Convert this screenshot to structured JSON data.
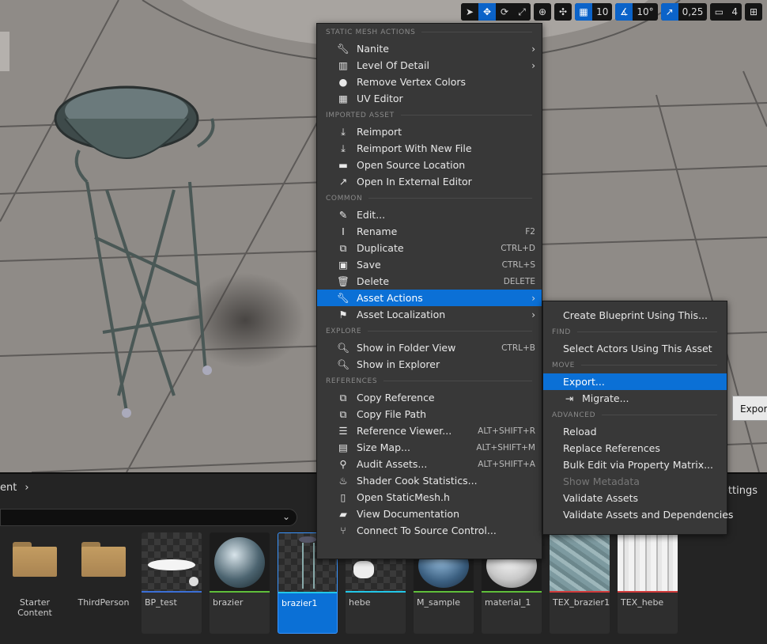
{
  "toolbar": {
    "grid_snap": "10",
    "rotation_snap": "10°",
    "scale_snap": "0,25",
    "camera_speed": "4"
  },
  "context_menu": {
    "sections": {
      "static_mesh_actions": "STATIC MESH ACTIONS",
      "imported_asset": "IMPORTED ASSET",
      "common": "COMMON",
      "explore": "EXPLORE",
      "references": "REFERENCES"
    },
    "items": {
      "nanite": "Nanite",
      "level_of_detail": "Level Of Detail",
      "remove_vertex_colors": "Remove Vertex Colors",
      "uv_editor": "UV Editor",
      "reimport": "Reimport",
      "reimport_new_file": "Reimport With New File",
      "open_source_location": "Open Source Location",
      "open_external_editor": "Open In External Editor",
      "edit": "Edit...",
      "rename": "Rename",
      "rename_sc": "F2",
      "duplicate": "Duplicate",
      "duplicate_sc": "CTRL+D",
      "save": "Save",
      "save_sc": "CTRL+S",
      "delete": "Delete",
      "delete_sc": "DELETE",
      "asset_actions": "Asset Actions",
      "asset_localization": "Asset Localization",
      "show_folder_view": "Show in Folder View",
      "show_folder_view_sc": "CTRL+B",
      "show_explorer": "Show in Explorer",
      "copy_reference": "Copy Reference",
      "copy_file_path": "Copy File Path",
      "reference_viewer": "Reference Viewer...",
      "reference_viewer_sc": "ALT+SHIFT+R",
      "size_map": "Size Map...",
      "size_map_sc": "ALT+SHIFT+M",
      "audit_assets": "Audit Assets...",
      "audit_assets_sc": "ALT+SHIFT+A",
      "shader_cook_stats": "Shader Cook Statistics...",
      "open_staticmesh_h": "Open StaticMesh.h",
      "view_documentation": "View Documentation",
      "connect_source_control": "Connect To Source Control..."
    }
  },
  "submenu": {
    "sections": {
      "find": "FIND",
      "move": "MOVE",
      "advanced": "ADVANCED"
    },
    "items": {
      "create_blueprint": "Create Blueprint Using This...",
      "select_actors": "Select Actors Using This Asset",
      "export": "Export...",
      "migrate": "Migrate...",
      "reload": "Reload",
      "replace_references": "Replace References",
      "bulk_edit": "Bulk Edit via Property Matrix...",
      "show_metadata": "Show Metadata",
      "validate_assets": "Validate Assets",
      "validate_assets_deps": "Validate Assets and Dependencies"
    }
  },
  "tooltip": {
    "text": "Export"
  },
  "content_browser": {
    "path_fragment": "ent",
    "settings_fragment": "ettings",
    "folders": [
      {
        "label": "Starter Content"
      },
      {
        "label": "ThirdPerson"
      }
    ],
    "assets": [
      {
        "label": "BP_test",
        "bar_color": "#3b6fd6"
      },
      {
        "label": "brazier",
        "bar_color": "#5fbf3a"
      },
      {
        "label": "brazier1",
        "bar_color": "#22c7e8"
      },
      {
        "label": "hebe",
        "bar_color": "#22c7e8"
      },
      {
        "label": "M_sample",
        "bar_color": "#5fbf3a"
      },
      {
        "label": "material_1",
        "bar_color": "#5fbf3a"
      },
      {
        "label": "TEX_brazier1",
        "bar_color": "#d13b3b"
      },
      {
        "label": "TEX_hebe",
        "bar_color": "#d13b3b"
      }
    ]
  }
}
